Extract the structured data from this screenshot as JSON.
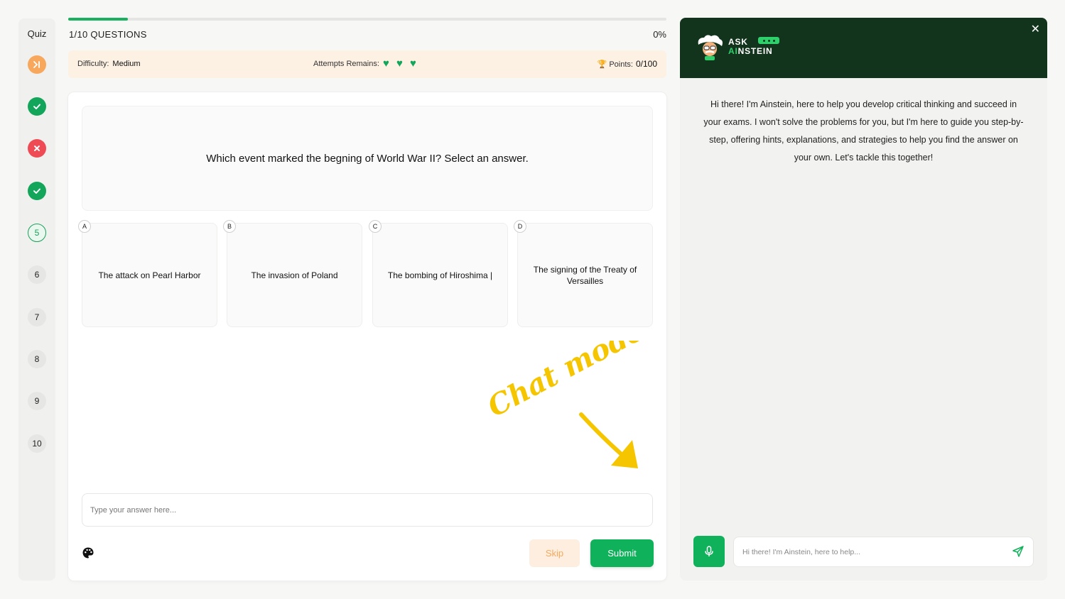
{
  "sidebar": {
    "title": "Quiz",
    "steps": [
      {
        "status": "skipped",
        "icon": "skip-icon",
        "label": ""
      },
      {
        "status": "correct",
        "icon": "check-icon",
        "label": ""
      },
      {
        "status": "wrong",
        "icon": "cross-icon",
        "label": ""
      },
      {
        "status": "correct",
        "icon": "check-icon",
        "label": ""
      },
      {
        "status": "current",
        "label": "5"
      },
      {
        "status": "todo",
        "label": "6"
      },
      {
        "status": "todo",
        "label": "7"
      },
      {
        "status": "todo",
        "label": "8"
      },
      {
        "status": "todo",
        "label": "9"
      },
      {
        "status": "todo",
        "label": "10"
      }
    ]
  },
  "progress": {
    "fraction": 0.1,
    "count_label": "1/10 QUESTIONS",
    "percent_label": "0%"
  },
  "info": {
    "difficulty_label": "Difficulty:",
    "difficulty_value": "Medium",
    "attempts_label": "Attempts Remains:",
    "attempts_remaining": 3,
    "points_label": "Points:",
    "points_value": "0/100"
  },
  "question": {
    "text": "Which event marked the begning of World War II? Select an answer.",
    "options": [
      {
        "letter": "A",
        "text": "The attack on Pearl Harbor"
      },
      {
        "letter": "B",
        "text": "The invasion of Poland"
      },
      {
        "letter": "C",
        "text": "The bombing of Hiroshima |"
      },
      {
        "letter": "D",
        "text": "The signing of the Treaty of Versailles"
      }
    ]
  },
  "annotation": {
    "text": "Chat mode"
  },
  "answer": {
    "placeholder": "Type your answer here...",
    "skip_label": "Skip",
    "submit_label": "Submit"
  },
  "chat": {
    "brand_line1": "ASK",
    "brand_ai": "AI",
    "brand_rest": "NSTEIN",
    "welcome": "Hi there! I'm Ainstein, here to help you develop critical thinking and succeed in your exams. I won't solve the problems for you, but I'm here to guide you step-by-step, offering hints, explanations, and strategies to help you find the answer on your own. Let's tackle this together!",
    "input_placeholder": "Hi there! I'm Ainstein, here to help...",
    "close_icon": "✕"
  },
  "colors": {
    "accent": "#0fb25a",
    "header": "#12331c",
    "warning": "#f7a85c",
    "error": "#ef4b55",
    "annotation": "#f5c600"
  }
}
